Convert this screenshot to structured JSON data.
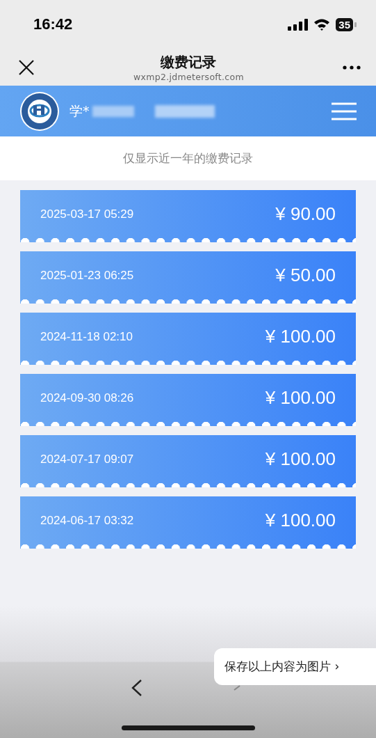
{
  "status_bar": {
    "time": "16:42",
    "battery": "35"
  },
  "nav_bar": {
    "title": "缴费记录",
    "url": "wxmp2.jdmetersoft.com"
  },
  "header": {
    "user_name": "学*"
  },
  "notice": "仅显示近一年的缴费记录",
  "records": [
    {
      "time": "2025-03-17 05:29",
      "amount": "¥ 90.00"
    },
    {
      "time": "2025-01-23 06:25",
      "amount": "¥ 50.00"
    },
    {
      "time": "2024-11-18 02:10",
      "amount": "¥ 100.00"
    },
    {
      "time": "2024-09-30 08:26",
      "amount": "¥ 100.00"
    },
    {
      "time": "2024-07-17 09:07",
      "amount": "¥ 100.00"
    },
    {
      "time": "2024-06-17 03:32",
      "amount": "¥ 100.00"
    }
  ],
  "save_popup": {
    "label": "保存以上内容为图片",
    "chevron": "›"
  }
}
